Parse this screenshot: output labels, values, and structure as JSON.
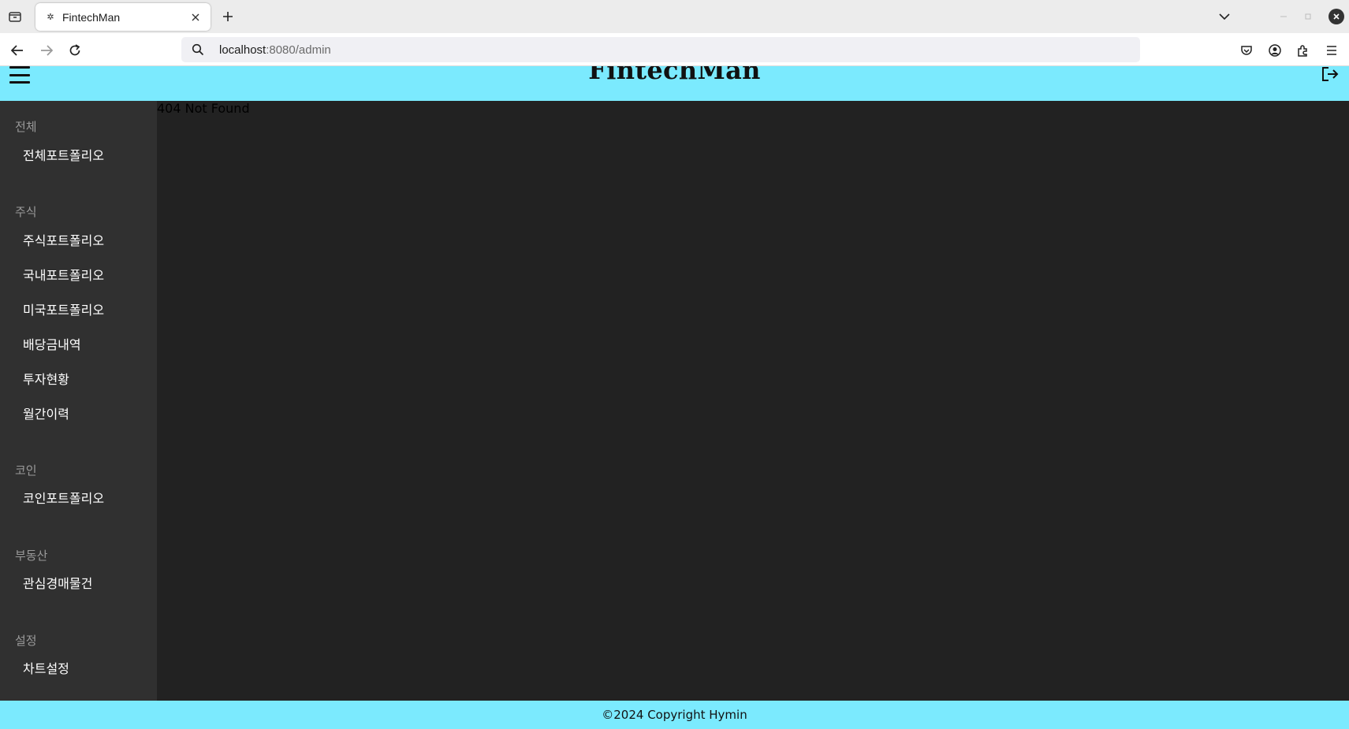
{
  "browser": {
    "tab": {
      "title": "FintechMan",
      "favicon": "gear-icon"
    },
    "url": {
      "host": "localhost",
      "rest": ":8080/admin"
    }
  },
  "app": {
    "title": "FintechMan",
    "content_text": "404 Not Found",
    "footer": "©2024 Copyright Hymin"
  },
  "sidebar": {
    "sections": [
      {
        "title": "전체",
        "items": [
          "전체포트폴리오"
        ]
      },
      {
        "title": "주식",
        "items": [
          "주식포트폴리오",
          "국내포트폴리오",
          "미국포트폴리오",
          "배당금내역",
          "투자현황",
          "월간이력"
        ]
      },
      {
        "title": "코인",
        "items": [
          "코인포트폴리오"
        ]
      },
      {
        "title": "부동산",
        "items": [
          "관심경매물건"
        ]
      },
      {
        "title": "설정",
        "items": [
          "차트설정"
        ]
      }
    ]
  },
  "colors": {
    "header_bg": "#7beafe",
    "sidebar_bg": "#303030",
    "content_bg": "#222222"
  }
}
